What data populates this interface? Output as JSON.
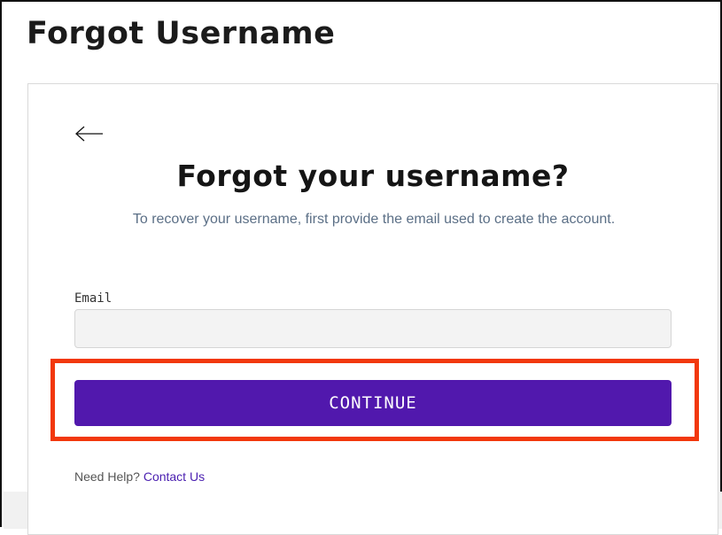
{
  "page": {
    "title": "Forgot Username"
  },
  "card": {
    "back_icon": "arrow-left-icon",
    "heading": "Forgot your username?",
    "subtext": "To recover your username, first provide the email used to create the account.",
    "email": {
      "label": "Email",
      "value": "",
      "placeholder": ""
    },
    "continue_label": "CONTINUE",
    "help": {
      "prefix": "Need Help?",
      "link_label": "Contact Us"
    }
  },
  "colors": {
    "brand_purple": "#5118ad",
    "highlight": "#f2380d",
    "subtext": "#5b6f86",
    "link": "#4a1fb0"
  }
}
